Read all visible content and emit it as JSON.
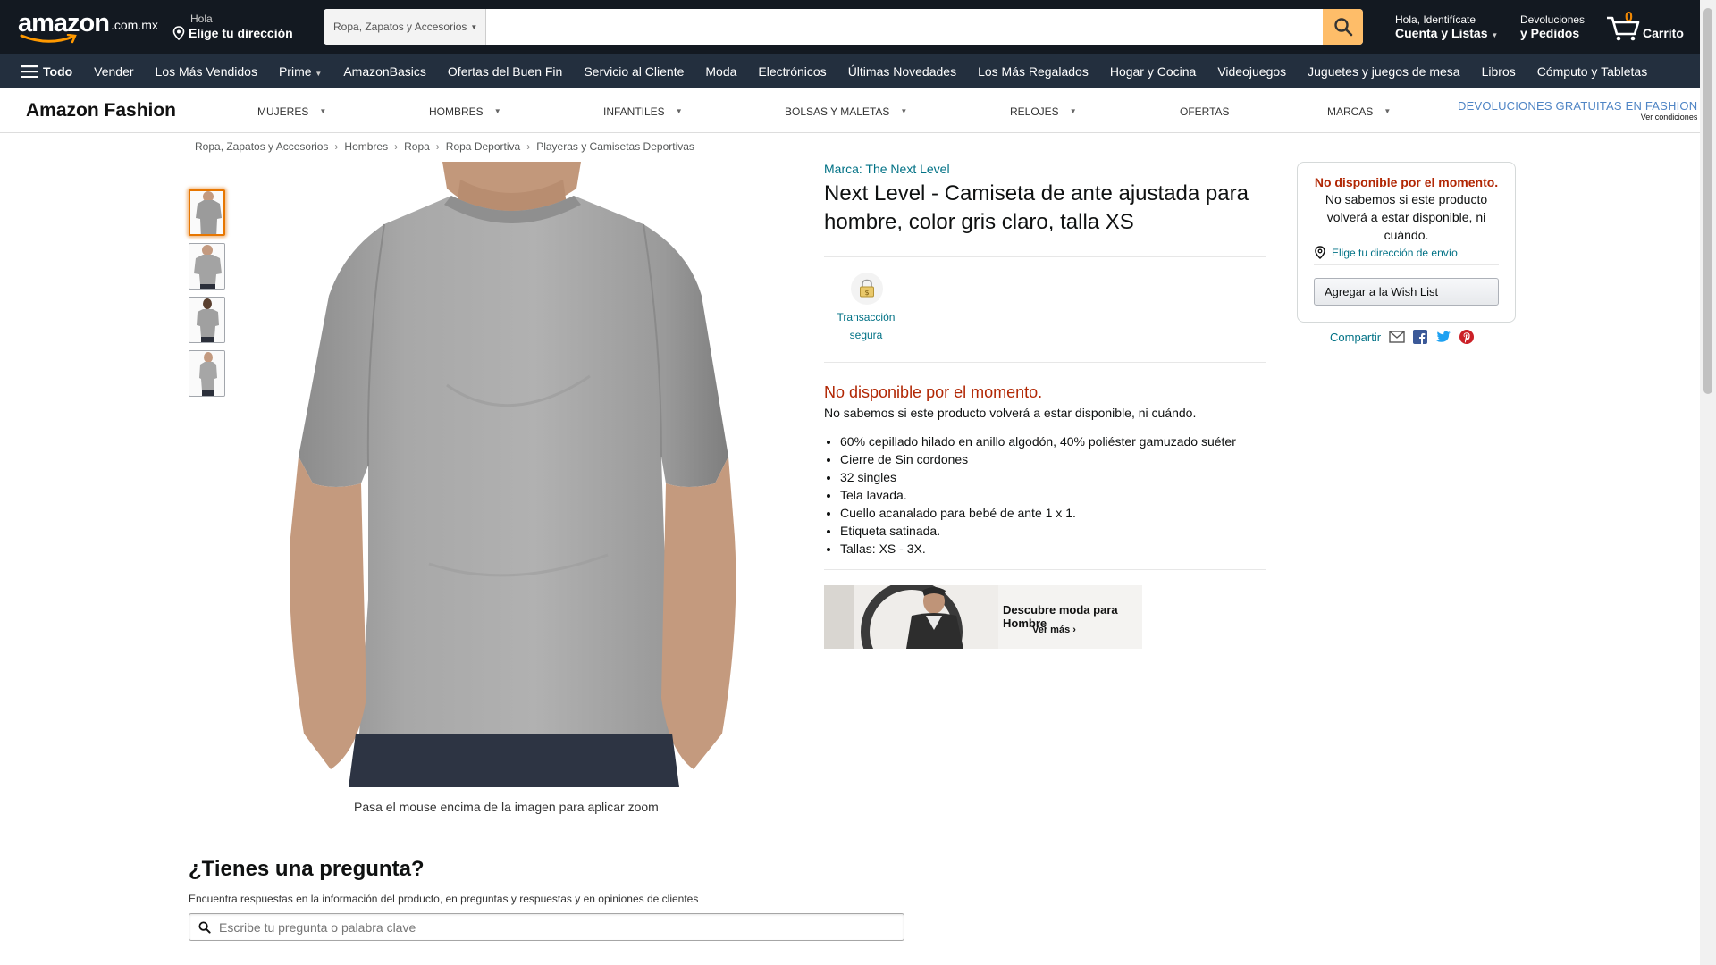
{
  "header": {
    "logo_text": "amazon",
    "logo_suffix": ".com.mx",
    "deliver_line1": "Hola",
    "deliver_line2": "Elige tu dirección",
    "search_category": "Ropa, Zapatos y Accesorios",
    "search_placeholder": "",
    "account_line1": "Hola, Identifícate",
    "account_line2": "Cuenta y Listas",
    "returns_line1": "Devoluciones",
    "returns_line2": "y Pedidos",
    "cart_count": "0",
    "cart_label": "Carrito"
  },
  "navbar": {
    "all_label": "Todo",
    "items": [
      "Vender",
      "Los Más Vendidos",
      "Prime",
      "AmazonBasics",
      "Ofertas del Buen Fin",
      "Servicio al Cliente",
      "Moda",
      "Electrónicos",
      "Últimas Novedades",
      "Los Más Regalados",
      "Hogar y Cocina",
      "Videojuegos",
      "Juguetes y juegos de mesa",
      "Libros",
      "Cómputo y Tabletas"
    ]
  },
  "fashion": {
    "brand": "Amazon Fashion",
    "items": [
      "MUJERES",
      "HOMBRES",
      "INFANTILES",
      "BOLSAS Y MALETAS",
      "RELOJES",
      "OFERTAS",
      "MARCAS"
    ],
    "promo_line1": "DEVOLUCIONES GRATUITAS EN FASHION",
    "promo_line2": "Ver condiciones"
  },
  "breadcrumb": [
    "Ropa, Zapatos y Accesorios",
    "Hombres",
    "Ropa",
    "Ropa Deportiva",
    "Playeras y Camisetas Deportivas"
  ],
  "breadcrumb_sep": "›",
  "image": {
    "zoom_hint": "Pasa el mouse encima de la imagen para aplicar zoom"
  },
  "product": {
    "brand_link": "Marca: The Next Level",
    "title": "Next Level - Camiseta de ante ajustada para hombre, color gris claro, talla XS",
    "secure_label": "Transacción segura",
    "unavailable": "No disponible por el momento.",
    "unavailable_detail": "No sabemos si este producto volverá a estar disponible, ni cuándo.",
    "bullets": [
      "60% cepillado hilado en anillo algodón, 40% poliéster gamuzado suéter",
      "Cierre de Sin cordones",
      "32 singles",
      "Tela lavada.",
      "Cuello acanalado para bebé de ante 1 x 1.",
      "Etiqueta satinada.",
      "Tallas: XS - 3X."
    ],
    "banner_title": "Descubre moda para Hombre",
    "banner_cta": "Ver más ›"
  },
  "buybox": {
    "title": "No disponible por el momento.",
    "detail": "No sabemos si este producto volverá a estar disponible, ni cuándo.",
    "address_link": "Elige tu dirección de envío",
    "wishlist_button": "Agregar a la Wish List",
    "share_label": "Compartir"
  },
  "questions": {
    "title": "¿Tienes una pregunta?",
    "subtitle": "Encuentra respuestas en la información del producto, en preguntas y respuestas y en opiniones de clientes",
    "placeholder": "Escribe tu pregunta o palabra clave"
  },
  "colors": {
    "header_bg": "#131921",
    "nav_bg": "#232f3e",
    "search_button": "#febd69",
    "link": "#007185",
    "unavailable": "#b12704",
    "cart_count": "#f08804"
  }
}
